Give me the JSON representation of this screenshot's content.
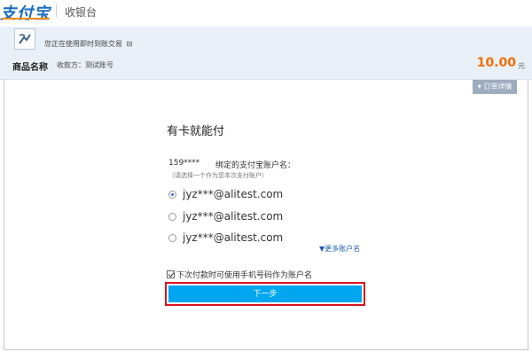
{
  "header": {
    "logo_text": "支付宝",
    "cashier_label": "收银台"
  },
  "band": {
    "notice": "您正在使用即时到账交易",
    "exit_icon": "exit-icon",
    "product_label": "商品名称",
    "payee": "收款方：测试账号",
    "amount": "10.00",
    "currency": "元"
  },
  "panel": {
    "order_detail_label": "订单详情",
    "title": "有卡就能付",
    "account_number": "159****",
    "bind_label": "绑定的支付宝账户名：",
    "bind_hint": "（请选择一个作为您本次支付账户）",
    "accounts": [
      {
        "label": "jyz***@alitest.com",
        "selected": true
      },
      {
        "label": "jyz***@alitest.com",
        "selected": false
      },
      {
        "label": "jyz***@alitest.com",
        "selected": false
      }
    ],
    "more_accounts": "更多账户名",
    "checkbox_label": "下次付款时可使用手机号码作为账户名",
    "checkbox_checked": true,
    "next_button": "下一步"
  },
  "colors": {
    "accent_blue": "#00a6f0",
    "amount_orange": "#f06d00",
    "highlight_red": "#d8141e"
  }
}
